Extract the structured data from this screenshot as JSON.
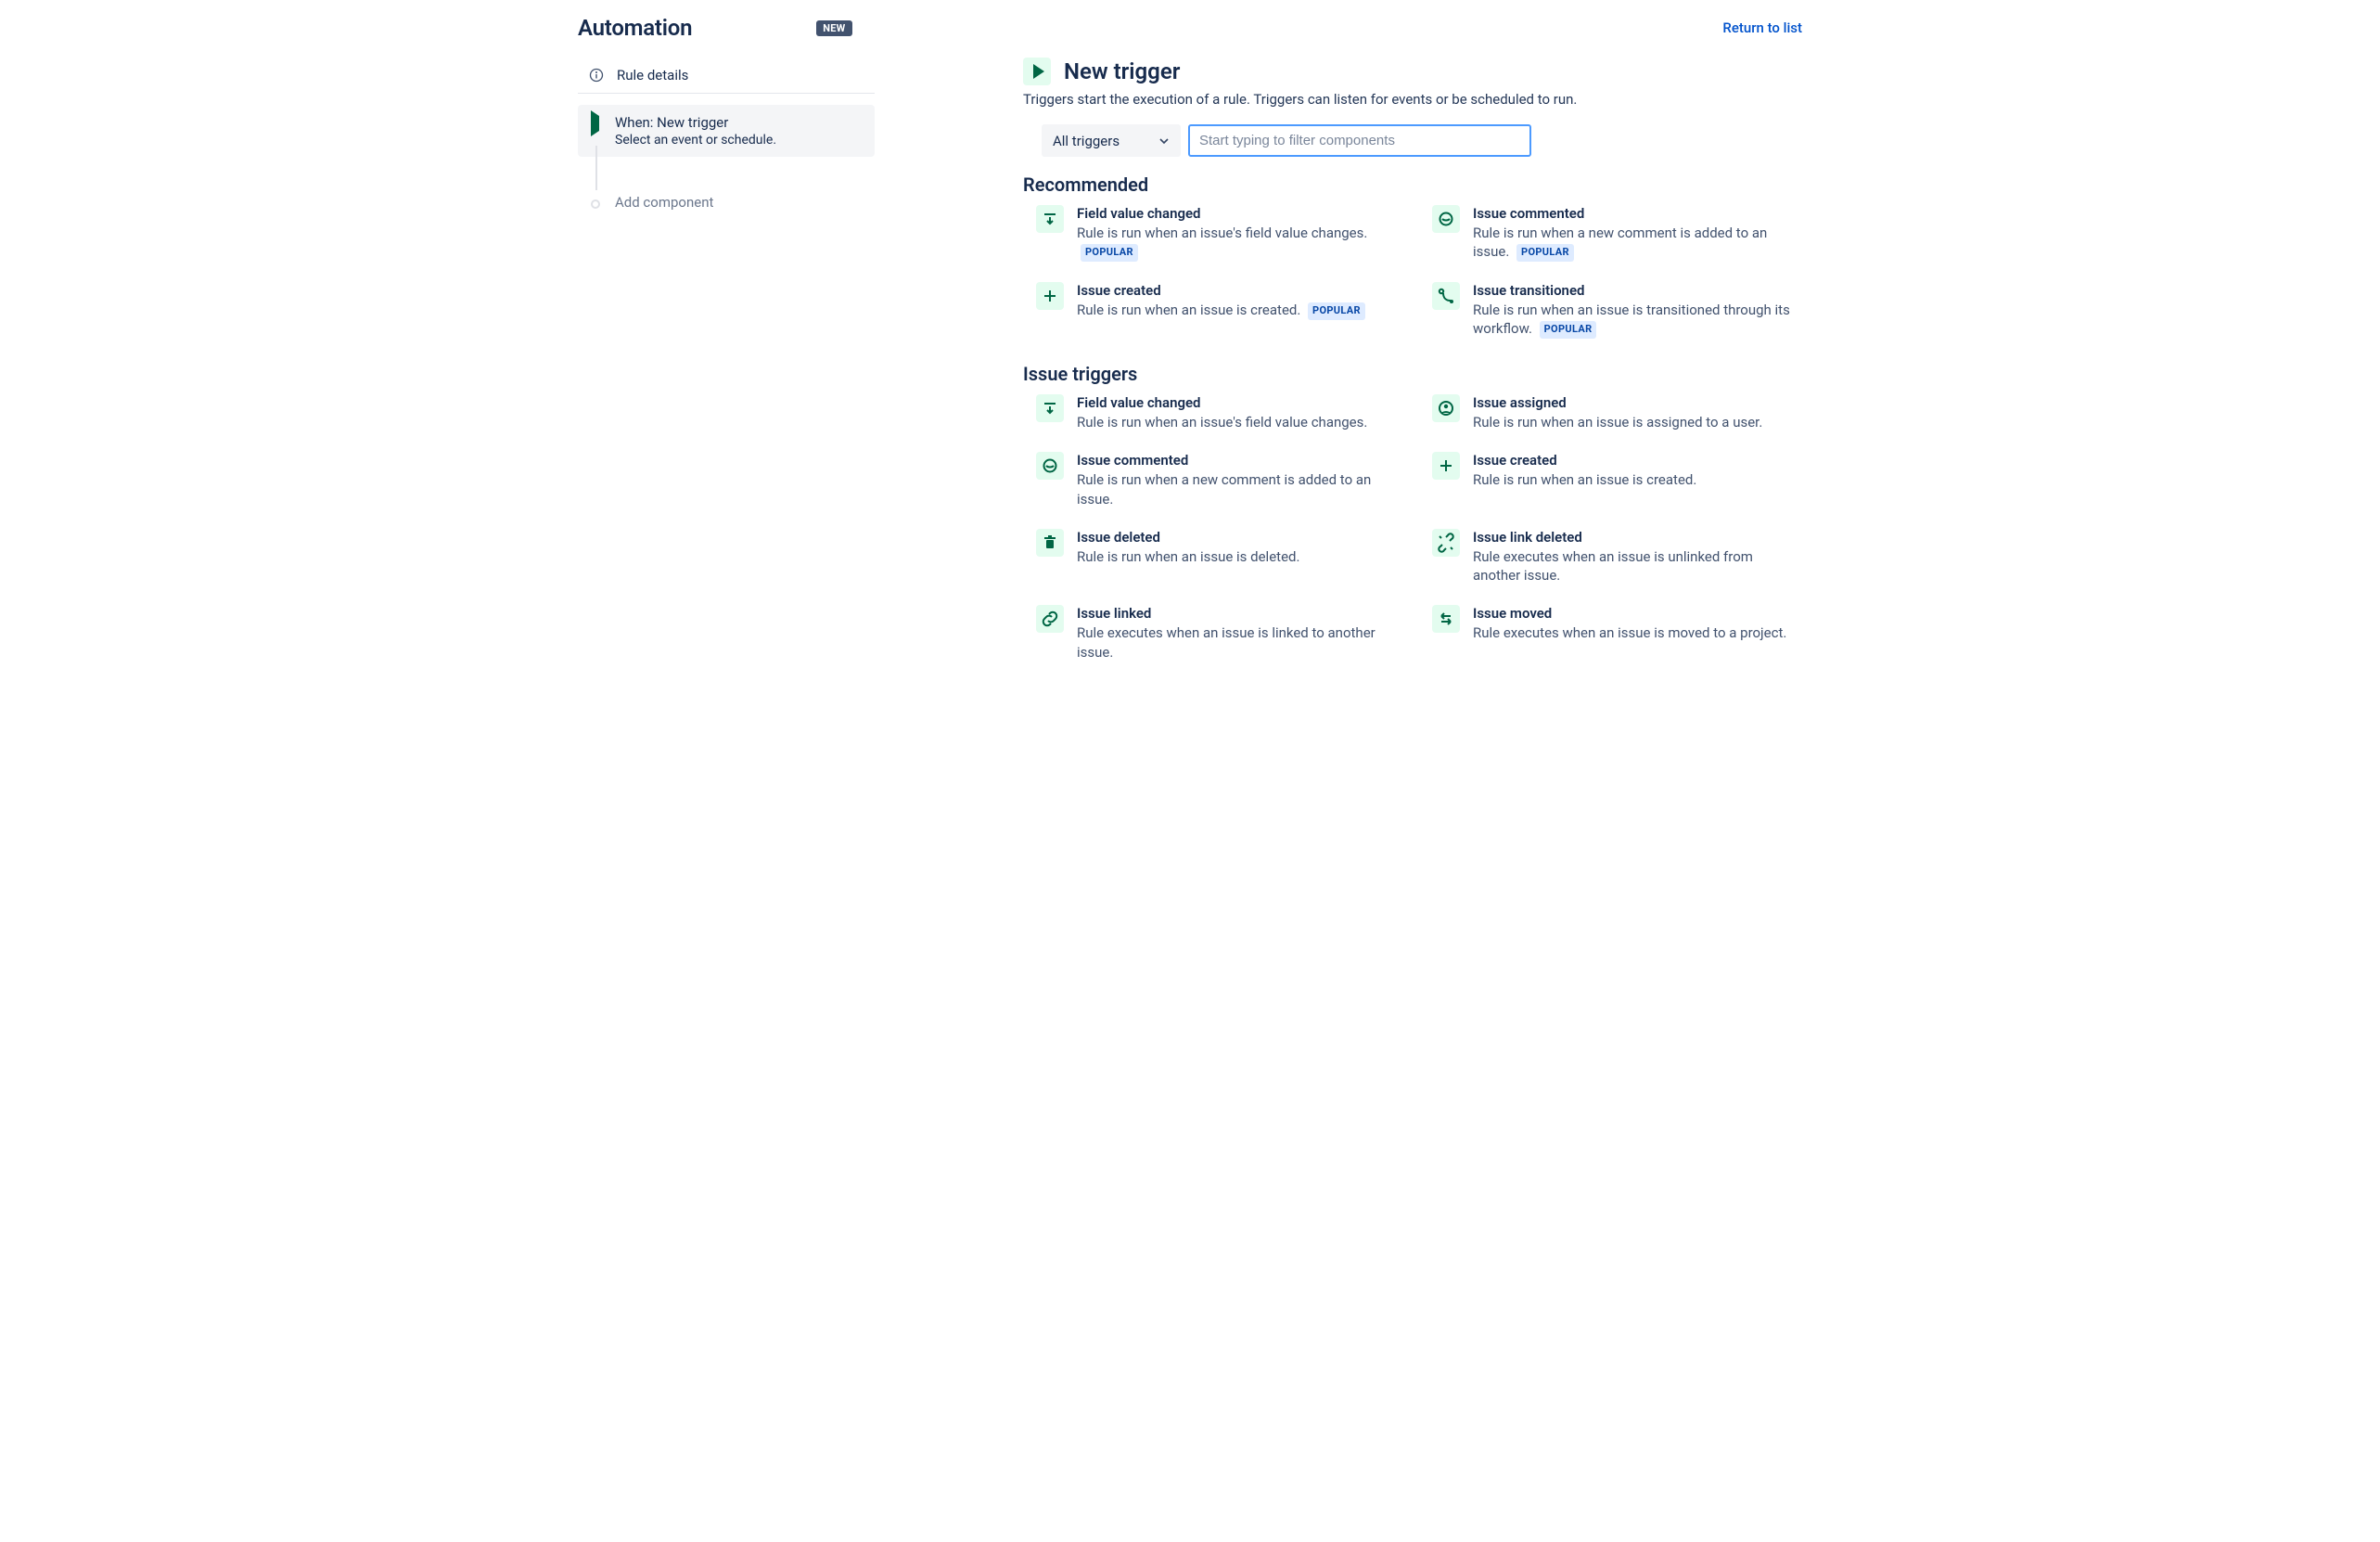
{
  "header": {
    "title": "Automation",
    "badge": "NEW",
    "return_link": "Return to list"
  },
  "sidebar": {
    "rule_details_label": "Rule details",
    "step": {
      "title": "When: New trigger",
      "subtitle": "Select an event or schedule."
    },
    "add_component_label": "Add component"
  },
  "main": {
    "title": "New trigger",
    "description": "Triggers start the execution of a rule. Triggers can listen for events or be scheduled to run.",
    "dropdown_label": "All triggers",
    "filter_placeholder": "Start typing to filter components",
    "popular_label": "POPULAR"
  },
  "sections": [
    {
      "title": "Recommended",
      "items": [
        {
          "icon": "field-changed",
          "title": "Field value changed",
          "desc": "Rule is run when an issue's field value changes.",
          "popular": true
        },
        {
          "icon": "comment",
          "title": "Issue commented",
          "desc": "Rule is run when a new comment is added to an issue.",
          "popular": true
        },
        {
          "icon": "plus",
          "title": "Issue created",
          "desc": "Rule is run when an issue is created.",
          "popular": true
        },
        {
          "icon": "transition",
          "title": "Issue transitioned",
          "desc": "Rule is run when an issue is transitioned through its workflow.",
          "popular": true
        }
      ]
    },
    {
      "title": "Issue triggers",
      "items": [
        {
          "icon": "field-changed",
          "title": "Field value changed",
          "desc": "Rule is run when an issue's field value changes.",
          "popular": false
        },
        {
          "icon": "person",
          "title": "Issue assigned",
          "desc": "Rule is run when an issue is assigned to a user.",
          "popular": false
        },
        {
          "icon": "comment",
          "title": "Issue commented",
          "desc": "Rule is run when a new comment is added to an issue.",
          "popular": false
        },
        {
          "icon": "plus",
          "title": "Issue created",
          "desc": "Rule is run when an issue is created.",
          "popular": false
        },
        {
          "icon": "trash",
          "title": "Issue deleted",
          "desc": "Rule is run when an issue is deleted.",
          "popular": false
        },
        {
          "icon": "unlink",
          "title": "Issue link deleted",
          "desc": "Rule executes when an issue is unlinked from another issue.",
          "popular": false
        },
        {
          "icon": "link",
          "title": "Issue linked",
          "desc": "Rule executes when an issue is linked to another issue.",
          "popular": false
        },
        {
          "icon": "move",
          "title": "Issue moved",
          "desc": "Rule executes when an issue is moved to a project.",
          "popular": false
        }
      ]
    }
  ]
}
